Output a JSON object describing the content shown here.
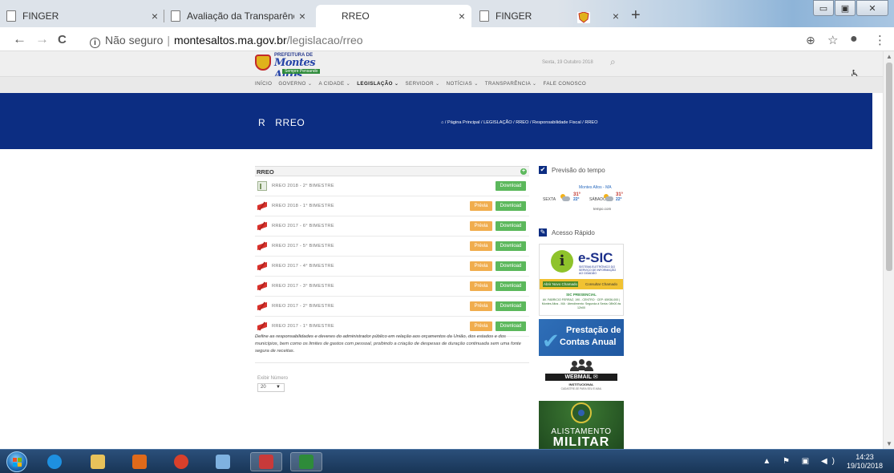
{
  "browser": {
    "tabs": [
      {
        "title": "FINGER",
        "active": false
      },
      {
        "title": "Avaliação da Transparência dos Mu",
        "active": false
      },
      {
        "title": "RREO",
        "active": true
      },
      {
        "title": "FINGER",
        "active": false
      }
    ],
    "close_glyph": "×",
    "new_tab_glyph": "+",
    "window_controls": [
      "▭",
      "▣",
      "✕"
    ],
    "url": {
      "security": "Não seguro",
      "domain": "montesaltos.ma.gov.br",
      "path": "/legislacao/rreo"
    },
    "nav": {
      "back": "←",
      "forward": "→",
      "reload": "C",
      "zoom": "⊕",
      "star": "☆",
      "profile": "●",
      "menu": "⋮"
    }
  },
  "site": {
    "logo": {
      "line1": "PREFEITURA DE",
      "name": "Montes Altos",
      "tagline": "Sempre Pensando"
    },
    "date": "Sexta, 19 Outubro 2018",
    "search_glyph": "⌕",
    "accessibility_glyph": "♿",
    "menu": [
      {
        "label": "INÍCIO",
        "active": false
      },
      {
        "label": "GOVERNO ⌄",
        "active": false
      },
      {
        "label": "A CIDADE ⌄",
        "active": false
      },
      {
        "label": "LEGISLAÇÃO ⌄",
        "active": true
      },
      {
        "label": "SERVIDOR ⌄",
        "active": false
      },
      {
        "label": "NOTÍCIAS ⌄",
        "active": false
      },
      {
        "label": "TRANSPARÊNCIA ⌄",
        "active": false
      },
      {
        "label": "FALE CONOSCO",
        "active": false
      }
    ],
    "hero": {
      "r": "R",
      "title": "RREO",
      "breadcrumb": "⌂ / Página Principal / LEGISLAÇÃO / RREO / Responsabilidade Fiscal / RREO"
    }
  },
  "panel": {
    "title": "RREO",
    "plus": "+",
    "preview_label": "Prévia",
    "download_label": "Download",
    "rows": [
      {
        "label": "RREO 2018 - 2° BIMESTRE",
        "icon": "doc",
        "preview": false
      },
      {
        "label": "RREO 2018 - 1° BIMESTRE",
        "icon": "pdf",
        "preview": true
      },
      {
        "label": "RREO 2017 - 6° BIMESTRE",
        "icon": "pdf",
        "preview": true
      },
      {
        "label": "RREO 2017 - 5° BIMESTRE",
        "icon": "pdf",
        "preview": true
      },
      {
        "label": "RREO 2017 - 4° BIMESTRE",
        "icon": "pdf",
        "preview": true
      },
      {
        "label": "RREO 2017 - 3° BIMESTRE",
        "icon": "pdf",
        "preview": true
      },
      {
        "label": "RREO 2017 - 2° BIMESTRE",
        "icon": "pdf",
        "preview": true
      },
      {
        "label": "RREO 2017 - 1° BIMESTRE",
        "icon": "pdf",
        "preview": true
      }
    ],
    "description": "Define as responsabilidades e deveres do administrador público em relação aos orçamentos da União, dos estados e dos municípios, bem como os limites de gastos com pessoal, proibindo a criação de despesas de duração continuada sem uma fonte segura de receitas.",
    "exibir_label": "Exibir Número",
    "exibir_value": "20",
    "exibir_caret": "▼"
  },
  "sidebar": {
    "check_glyph": "✔",
    "weather": {
      "heading": "Previsão do tempo",
      "city": "Montes Altos - MA",
      "day1": "SEXTA",
      "day1_max": "31°",
      "day1_min": "22°",
      "day2": "SÁBADO",
      "day2_max": "31°",
      "day2_min": "22°",
      "source": "tempo.com"
    },
    "quick": {
      "heading": "Acesso Rápido",
      "esic": {
        "i": "i",
        "title": "e-SIC",
        "subtitle": "SISTEMA ELETRÔNICO DO SERVIÇO DE INFORMAÇÃO AO CIDADÃO",
        "btn1": "Abrir Novo Chamado",
        "btn2": "Consultar Chamado",
        "presencial": "SIC PRESENCIAL",
        "address": "AV. FABRICIO FERRAZ, 190 - CENTRO · CEP: 65936-000 | Montes Altos - MA · Atendimento: Segunda à Sexta: 08h00 às 12h00"
      },
      "prestacao": {
        "line1": "Prestação de",
        "line2": "Contas Anual",
        "check": "✔"
      },
      "webmail": {
        "title": "WEBMAIL ✉",
        "sub": "INSTITUCIONAL",
        "cad": "CADASTRE-SE PARA SEU E-MAIL"
      },
      "alistamento": {
        "line1": "ALISTAMENTO",
        "line2": "MILITAR"
      }
    }
  },
  "taskbar": {
    "clock_time": "14:23",
    "clock_date": "19/10/2018",
    "tray": "▲ ⚑ ▣ ◀)",
    "icons": [
      {
        "name": "ie-icon",
        "color": "#1e90e0"
      },
      {
        "name": "explorer-icon",
        "color": "#e8c25a"
      },
      {
        "name": "media-player-icon",
        "color": "#e06a1a"
      },
      {
        "name": "chrome-icon",
        "color": "#d9402b"
      },
      {
        "name": "paint-icon",
        "color": "#7fb2e0"
      },
      {
        "name": "snipping-tool-icon",
        "color": "#c83a3a"
      },
      {
        "name": "excel-icon",
        "color": "#2e8b3a"
      }
    ]
  }
}
